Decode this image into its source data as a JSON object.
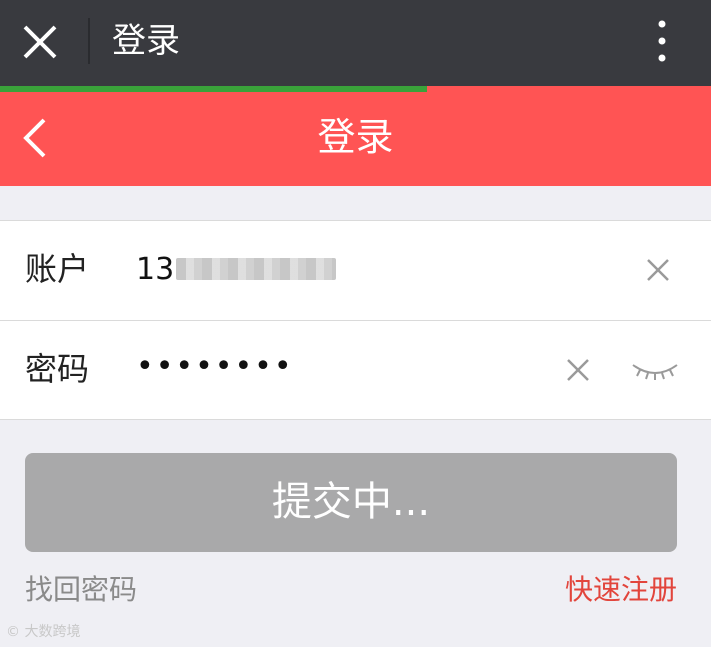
{
  "topbar": {
    "title": "登录",
    "close_icon": "close-icon",
    "more_icon": "more-vertical-icon"
  },
  "progress": {
    "value_percent": 60,
    "color": "#3aa23a"
  },
  "header": {
    "title": "登录",
    "back_icon": "chevron-left-icon",
    "bg_color": "#ff5454"
  },
  "form": {
    "account": {
      "label": "账户",
      "value_visible": "13"
    },
    "password": {
      "label": "密码",
      "value": "••••••••"
    }
  },
  "submit": {
    "label": "提交中..."
  },
  "links": {
    "forgot": "找回密码",
    "register": "快速注册"
  },
  "watermark": {
    "text": "大数跨境"
  }
}
